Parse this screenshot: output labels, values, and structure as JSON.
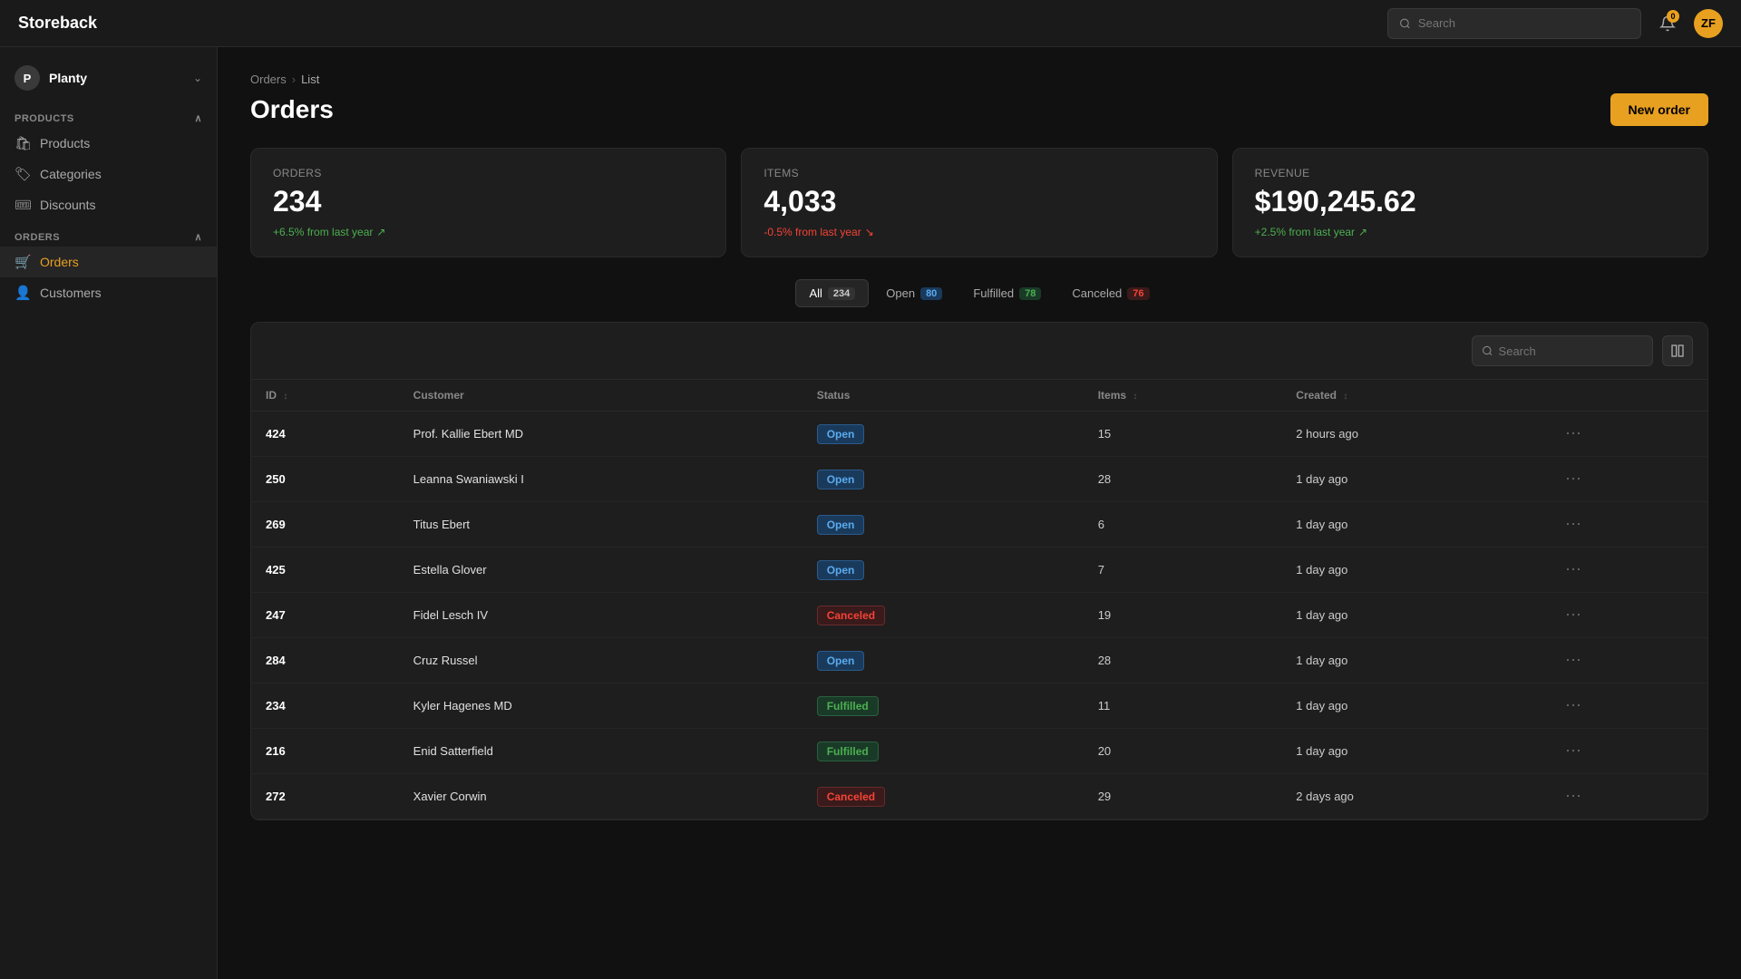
{
  "app": {
    "logo": "Storeback",
    "search_placeholder": "Search",
    "bell_count": "0",
    "avatar_initials": "ZF"
  },
  "sidebar": {
    "workspace_name": "Planty",
    "workspace_initial": "P",
    "sections": [
      {
        "label": "Products",
        "items": [
          {
            "id": "products",
            "label": "Products",
            "icon": "🛍",
            "active": false
          },
          {
            "id": "categories",
            "label": "Categories",
            "icon": "🏷",
            "active": false
          },
          {
            "id": "discounts",
            "label": "Discounts",
            "icon": "🎟",
            "active": false
          }
        ]
      },
      {
        "label": "Orders",
        "items": [
          {
            "id": "orders",
            "label": "Orders",
            "icon": "🛒",
            "active": true
          },
          {
            "id": "customers",
            "label": "Customers",
            "icon": "👤",
            "active": false
          }
        ]
      }
    ]
  },
  "breadcrumb": {
    "parent": "Orders",
    "current": "List"
  },
  "page": {
    "title": "Orders",
    "new_order_label": "New order"
  },
  "stats": [
    {
      "label": "Orders",
      "value": "234",
      "change": "+6.5% from last year",
      "positive": true
    },
    {
      "label": "Items",
      "value": "4,033",
      "change": "-0.5% from last year",
      "positive": false
    },
    {
      "label": "Revenue",
      "value": "$190,245.62",
      "change": "+2.5% from last year",
      "positive": true
    }
  ],
  "filter_tabs": [
    {
      "label": "All",
      "count": "234",
      "badge_class": "badge-all"
    },
    {
      "label": "Open",
      "count": "80",
      "badge_class": "badge-open"
    },
    {
      "label": "Fulfilled",
      "count": "78",
      "badge_class": "badge-fulfilled"
    },
    {
      "label": "Canceled",
      "count": "76",
      "badge_class": "badge-canceled"
    }
  ],
  "table": {
    "search_placeholder": "Search",
    "columns": [
      {
        "key": "id",
        "label": "ID",
        "sortable": true
      },
      {
        "key": "customer",
        "label": "Customer",
        "sortable": false
      },
      {
        "key": "status",
        "label": "Status",
        "sortable": false
      },
      {
        "key": "items",
        "label": "Items",
        "sortable": true
      },
      {
        "key": "created",
        "label": "Created",
        "sortable": true
      }
    ],
    "rows": [
      {
        "id": "424",
        "customer": "Prof. Kallie Ebert MD",
        "status": "Open",
        "items": "15",
        "created": "2 hours ago"
      },
      {
        "id": "250",
        "customer": "Leanna Swaniawski I",
        "status": "Open",
        "items": "28",
        "created": "1 day ago"
      },
      {
        "id": "269",
        "customer": "Titus Ebert",
        "status": "Open",
        "items": "6",
        "created": "1 day ago"
      },
      {
        "id": "425",
        "customer": "Estella Glover",
        "status": "Open",
        "items": "7",
        "created": "1 day ago"
      },
      {
        "id": "247",
        "customer": "Fidel Lesch IV",
        "status": "Canceled",
        "items": "19",
        "created": "1 day ago"
      },
      {
        "id": "284",
        "customer": "Cruz Russel",
        "status": "Open",
        "items": "28",
        "created": "1 day ago"
      },
      {
        "id": "234",
        "customer": "Kyler Hagenes MD",
        "status": "Fulfilled",
        "items": "11",
        "created": "1 day ago"
      },
      {
        "id": "216",
        "customer": "Enid Satterfield",
        "status": "Fulfilled",
        "items": "20",
        "created": "1 day ago"
      },
      {
        "id": "272",
        "customer": "Xavier Corwin",
        "status": "Canceled",
        "items": "29",
        "created": "2 days ago"
      }
    ]
  }
}
